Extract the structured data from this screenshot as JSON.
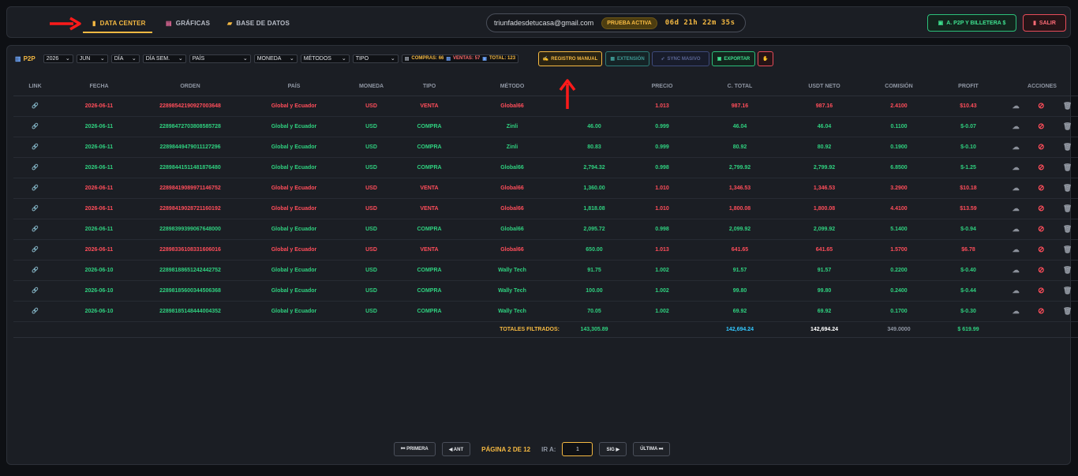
{
  "nav": {
    "tabs": [
      {
        "label": "DATA CENTER",
        "icon": "database-icon"
      },
      {
        "label": "GRÁFICAS",
        "icon": "chart-icon"
      },
      {
        "label": "BASE DE DATOS",
        "icon": "folder-icon"
      }
    ],
    "email": "triunfadesdetucasa@gmail.com",
    "trial_badge": "PRUEBA ACTIVA",
    "timer": "06d 21h 22m 35s",
    "p2p_button": "A. P2P Y BILLETERA $",
    "logout_button": "SALIR"
  },
  "filters": {
    "label": "P2P",
    "year": "2026",
    "month": "JUN",
    "day": "DÍA",
    "weekday": "DÍA SEM.",
    "country": "PAÍS",
    "currency": "MONEDA",
    "methods": "MÉTODOS",
    "type": "TIPO",
    "stats": {
      "compras": "COMPRAS: 66",
      "ventas": "VENTAS: 57",
      "total": "TOTAL: 123"
    }
  },
  "actions": {
    "manual": "REGISTRO MANUAL",
    "extension": "EXTENSIÓN",
    "sync": "SYNC MASIVO",
    "export": "EXPORTAR"
  },
  "table": {
    "headers": [
      "LINK",
      "FECHA",
      "ORDEN",
      "PAÍS",
      "MONEDA",
      "TIPO",
      "MÉTODO",
      "",
      "PRECIO",
      "C. TOTAL",
      "USDT NETO",
      "COMISIÓN",
      "PROFIT",
      "ACCIONES"
    ],
    "rows": [
      {
        "fecha": "2026-06-11",
        "orden": "22898542190927003648",
        "pais": "Global y Ecuador",
        "moneda": "USD",
        "tipo": "VENTA",
        "metodo": "Global66",
        "monto": "",
        "precio": "1.013",
        "ctotal": "987.16",
        "usdt": "987.16",
        "comision": "2.4100",
        "profit": "$10.43"
      },
      {
        "fecha": "2026-06-11",
        "orden": "22898472703808585728",
        "pais": "Global y Ecuador",
        "moneda": "USD",
        "tipo": "COMPRA",
        "metodo": "Zinli",
        "monto": "46.00",
        "precio": "0.999",
        "ctotal": "46.04",
        "usdt": "46.04",
        "comision": "0.1100",
        "profit": "$-0.07"
      },
      {
        "fecha": "2026-06-11",
        "orden": "22898449479011127296",
        "pais": "Global y Ecuador",
        "moneda": "USD",
        "tipo": "COMPRA",
        "metodo": "Zinli",
        "monto": "80.83",
        "precio": "0.999",
        "ctotal": "80.92",
        "usdt": "80.92",
        "comision": "0.1900",
        "profit": "$-0.10"
      },
      {
        "fecha": "2026-06-11",
        "orden": "22898441511481876480",
        "pais": "Global y Ecuador",
        "moneda": "USD",
        "tipo": "COMPRA",
        "metodo": "Global66",
        "monto": "2,794.32",
        "precio": "0.998",
        "ctotal": "2,799.92",
        "usdt": "2,799.92",
        "comision": "6.8500",
        "profit": "$-1.25"
      },
      {
        "fecha": "2026-06-11",
        "orden": "22898419089971146752",
        "pais": "Global y Ecuador",
        "moneda": "USD",
        "tipo": "VENTA",
        "metodo": "Global66",
        "monto": "1,360.00",
        "precio": "1.010",
        "ctotal": "1,346.53",
        "usdt": "1,346.53",
        "comision": "3.2900",
        "profit": "$10.18"
      },
      {
        "fecha": "2026-06-11",
        "orden": "22898419028721160192",
        "pais": "Global y Ecuador",
        "moneda": "USD",
        "tipo": "VENTA",
        "metodo": "Global66",
        "monto": "1,818.08",
        "precio": "1.010",
        "ctotal": "1,800.08",
        "usdt": "1,800.08",
        "comision": "4.4100",
        "profit": "$13.59"
      },
      {
        "fecha": "2026-06-11",
        "orden": "22898399399067648000",
        "pais": "Global y Ecuador",
        "moneda": "USD",
        "tipo": "COMPRA",
        "metodo": "Global66",
        "monto": "2,095.72",
        "precio": "0.998",
        "ctotal": "2,099.92",
        "usdt": "2,099.92",
        "comision": "5.1400",
        "profit": "$-0.94"
      },
      {
        "fecha": "2026-06-11",
        "orden": "22898336108331606016",
        "pais": "Global y Ecuador",
        "moneda": "USD",
        "tipo": "VENTA",
        "metodo": "Global66",
        "monto": "650.00",
        "precio": "1.013",
        "ctotal": "641.65",
        "usdt": "641.65",
        "comision": "1.5700",
        "profit": "$6.78"
      },
      {
        "fecha": "2026-06-10",
        "orden": "22898188651242442752",
        "pais": "Global y Ecuador",
        "moneda": "USD",
        "tipo": "COMPRA",
        "metodo": "Wally Tech",
        "monto": "91.75",
        "precio": "1.002",
        "ctotal": "91.57",
        "usdt": "91.57",
        "comision": "0.2200",
        "profit": "$-0.40"
      },
      {
        "fecha": "2026-06-10",
        "orden": "22898185600344506368",
        "pais": "Global y Ecuador",
        "moneda": "USD",
        "tipo": "COMPRA",
        "metodo": "Wally Tech",
        "monto": "100.00",
        "precio": "1.002",
        "ctotal": "99.80",
        "usdt": "99.80",
        "comision": "0.2400",
        "profit": "$-0.44"
      },
      {
        "fecha": "2026-06-10",
        "orden": "22898185148444004352",
        "pais": "Global y Ecuador",
        "moneda": "USD",
        "tipo": "COMPRA",
        "metodo": "Wally Tech",
        "monto": "70.05",
        "precio": "1.002",
        "ctotal": "69.92",
        "usdt": "69.92",
        "comision": "0.1700",
        "profit": "$-0.30"
      }
    ],
    "totals": {
      "label": "TOTALES FILTRADOS:",
      "monto": "143,305.89",
      "ctotal": "142,694.24",
      "usdt": "142,694.24",
      "comision": "349.0000",
      "profit": "$ 619.99"
    }
  },
  "pagination": {
    "first": "⏮ PRIMERA",
    "prev": "◀ ANT",
    "info": "PÁGINA 2 DE 12",
    "goto_label": "IR A:",
    "goto_value": "1",
    "next": "SIG ▶",
    "last": "ÚLTIMA ⏭"
  }
}
